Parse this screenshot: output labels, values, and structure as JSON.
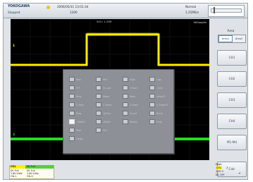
{
  "header": {
    "brand": "YOKOGAWA",
    "state": "Stopped",
    "datetime": "2006/05/31 13:01:34",
    "count": "1200",
    "acq_mode": "Normal",
    "sample_rate": "1.25MS/s"
  },
  "screen": {
    "timebase_readout": "500 / 1.25M",
    "div_readout": "500us/div",
    "marker_ch1": "1",
    "marker_ch2": "2"
  },
  "menu": {
    "items": [
      [
        "Max",
        "Min",
        "High",
        "Low"
      ],
      [
        "P-P",
        "Hi-Low",
        "+Over",
        "-Over"
      ],
      [
        "Rms",
        "Mean",
        "Sdev",
        "IntegTY"
      ],
      [
        "C.Rms",
        "C.Mean",
        "C.Sdev",
        "C.IntegTY"
      ],
      [
        "Freq",
        "1/Freq",
        "Count",
        "Burst"
      ],
      [
        "+Width",
        "-Width",
        "Period",
        "Duty"
      ],
      [
        "Rise",
        "Fall",
        "",
        ""
      ],
      [
        "Delay",
        "",
        "",
        ""
      ]
    ],
    "checked": [
      "+Width"
    ]
  },
  "softkeys": {
    "title": "Area",
    "toggle": [
      "Area1",
      "Area2"
    ],
    "toggle_selected": "Area1",
    "buttons": [
      "CH1",
      "CH2",
      "CH3",
      "CH4",
      "M1-M4",
      "Calc"
    ]
  },
  "status": {
    "ch1_tab": "CH1",
    "ch2_tab": "DC Full",
    "ch1_lines": [
      "DC Full",
      "1.00 V/div",
      "Ofs 1"
    ],
    "ch2_lines": [
      "DC Full",
      "1.00 V/div",
      "Ofs 0"
    ],
    "trigger": {
      "title": "Edge",
      "source": "CH1",
      "level": "1.00 V",
      "coupling": "DC OFF"
    }
  },
  "colors": {
    "ch1_yellow": "#ffee00",
    "ch2_green": "#22dd22",
    "screen_bg": "#000000"
  }
}
